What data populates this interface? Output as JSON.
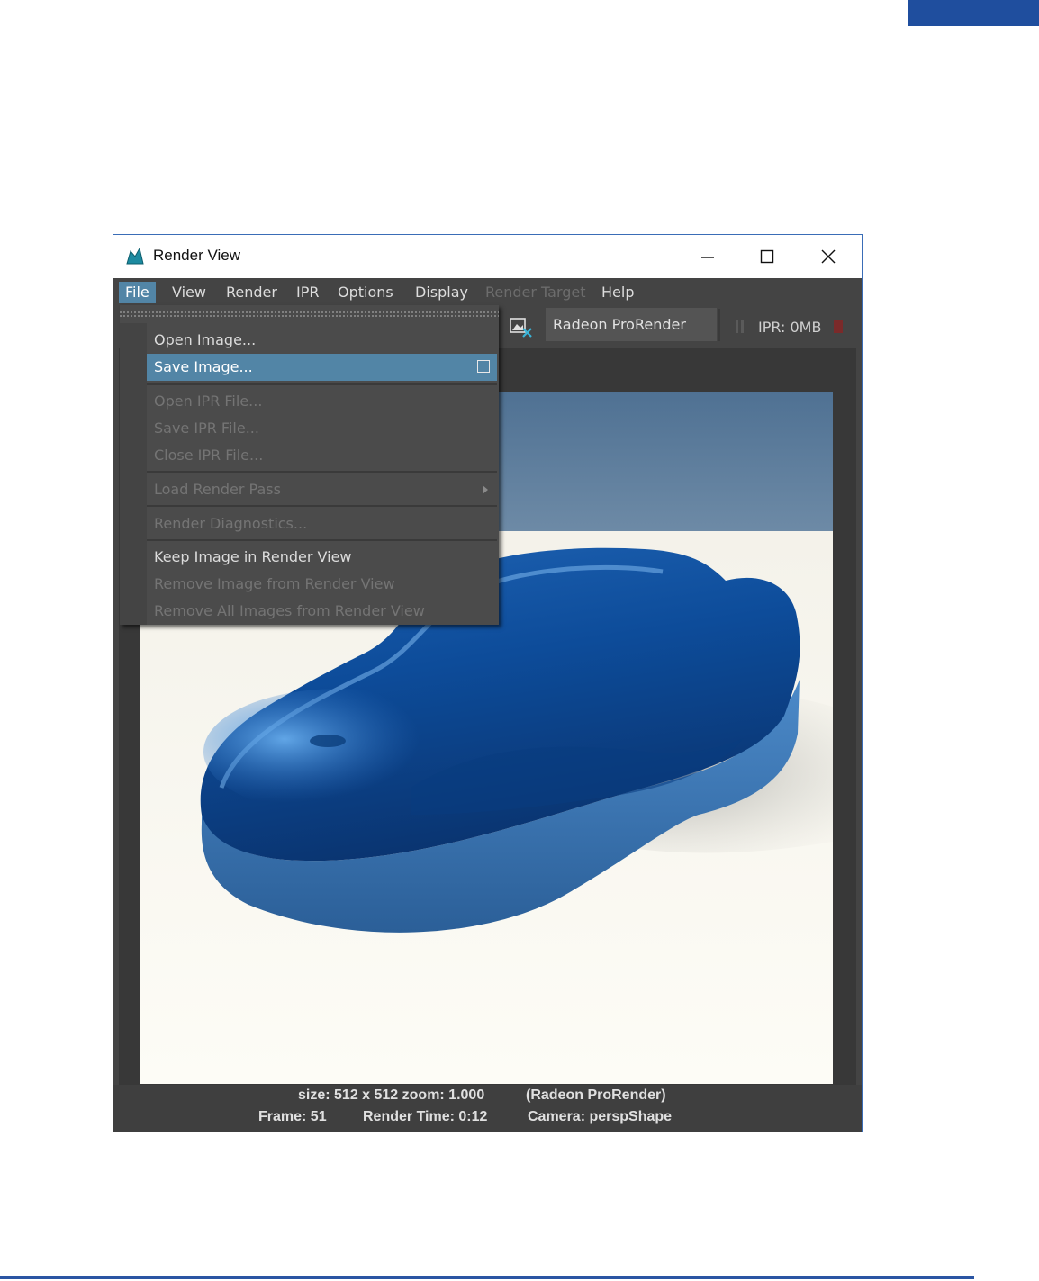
{
  "page": {
    "accent_color": "#1f4e9e"
  },
  "window": {
    "title": "Render View",
    "app_icon": "maya-icon",
    "controls": {
      "minimize": "minimize-icon",
      "maximize": "maximize-icon",
      "close": "close-icon"
    }
  },
  "menubar": {
    "items": [
      {
        "label": "File",
        "state": "active"
      },
      {
        "label": "View",
        "state": "normal"
      },
      {
        "label": "Render",
        "state": "normal"
      },
      {
        "label": "IPR",
        "state": "normal"
      },
      {
        "label": "Options",
        "state": "normal"
      },
      {
        "label": "Display",
        "state": "normal"
      },
      {
        "label": "Render Target",
        "state": "disabled"
      },
      {
        "label": "Help",
        "state": "normal"
      }
    ]
  },
  "toolbar": {
    "remove_image_icon": "image-remove-icon",
    "renderer": "Radeon ProRender",
    "pause_icon": "pause-icon",
    "ipr_memory": "IPR: 0MB",
    "stop_icon": "stop-icon"
  },
  "file_menu": {
    "items": [
      {
        "label": "Open Image...",
        "enabled": true
      },
      {
        "label": "Save Image...",
        "enabled": true,
        "highlighted": true,
        "has_option_box": true
      },
      {
        "label": "Open IPR File...",
        "enabled": false
      },
      {
        "label": "Save IPR File...",
        "enabled": false
      },
      {
        "label": "Close IPR File...",
        "enabled": false
      },
      {
        "label": "Load Render Pass",
        "enabled": false,
        "has_submenu": true
      },
      {
        "label": "Render Diagnostics...",
        "enabled": false
      },
      {
        "label": "Keep Image in Render View",
        "enabled": true
      },
      {
        "label": "Remove Image from Render View",
        "enabled": false
      },
      {
        "label": "Remove All Images from Render View",
        "enabled": false
      }
    ]
  },
  "render_image": {
    "subject": "blue car-shaped clay model render"
  },
  "status": {
    "size_zoom": "size: 512 x 512 zoom: 1.000",
    "renderer": "(Radeon ProRender)",
    "frame": "Frame: 51",
    "render_time": "Render Time: 0:12",
    "camera": "Camera: perspShape"
  }
}
